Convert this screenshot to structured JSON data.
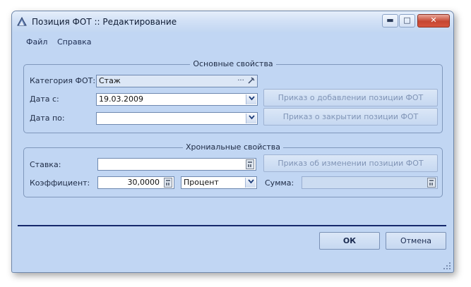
{
  "window": {
    "title": "Позиция ФОТ :: Редактирование",
    "controls": {
      "minimize": "▬",
      "maximize": "□",
      "close": "✕"
    }
  },
  "menu": {
    "items": [
      "Файл",
      "Справка"
    ]
  },
  "main_group": {
    "legend": "Основные свойства",
    "category": {
      "label": "Категория ФОТ:",
      "value": "Стаж",
      "ellipsis": "···"
    },
    "date_from": {
      "label": "Дата с:",
      "value": "19.03.2009"
    },
    "date_to": {
      "label": "Дата по:",
      "value": ""
    },
    "btn_add_order": "Приказ о добавлении позиции ФОТ",
    "btn_close_order": "Приказ о закрытии позиции ФОТ"
  },
  "chron_group": {
    "legend": "Хрониальные свойства",
    "rate": {
      "label": "Ставка:",
      "value": ""
    },
    "coef": {
      "label": "Коэффициент:",
      "value": "30,0000"
    },
    "coef_unit": "Процент",
    "sum": {
      "label": "Сумма:",
      "value": ""
    },
    "btn_change_order": "Приказ об изменении позиции ФОТ"
  },
  "footer": {
    "ok": "ОК",
    "cancel": "Отмена"
  },
  "colors": {
    "window_bg": "#c1d6f3",
    "separator": "#15286b",
    "accent": "#1d3d7a"
  },
  "icons": [
    "app-icon",
    "ellipsis-icon",
    "clear-icon",
    "dropdown-arrow-icon",
    "calculator-icon",
    "resize-grip-icon"
  ]
}
